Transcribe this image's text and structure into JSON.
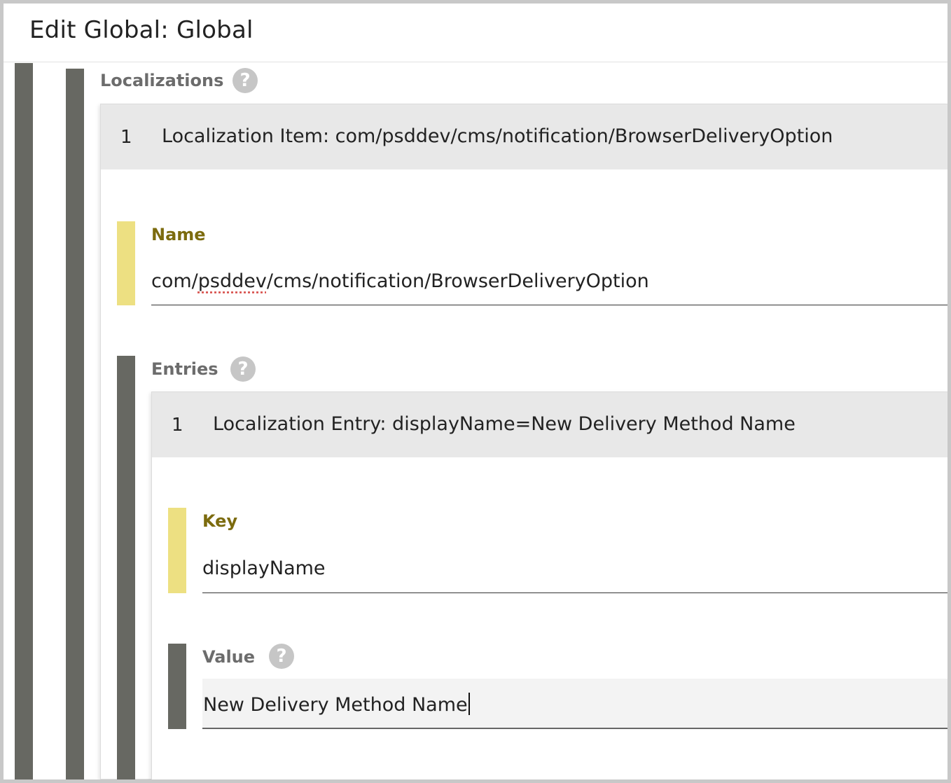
{
  "header": {
    "title": "Edit Global: Global"
  },
  "localizations": {
    "label": "Localizations",
    "help_icon": "question-mark-icon",
    "items": [
      {
        "index": "1",
        "title": "Localization Item: com/psddev/cms/notification/BrowserDeliveryOption",
        "name_field": {
          "label": "Name",
          "value_prefix": "com/",
          "value_flagged": "psddev",
          "value_suffix": "/cms/notification/BrowserDeliveryOption"
        },
        "entries": {
          "label": "Entries",
          "help_icon": "question-mark-icon",
          "items": [
            {
              "index": "1",
              "title": "Localization Entry: displayName=New Delivery Method Name",
              "key_field": {
                "label": "Key",
                "value": "displayName"
              },
              "value_field": {
                "label": "Value",
                "help_icon": "question-mark-icon",
                "value": "New Delivery Method Name"
              }
            }
          ]
        }
      }
    ]
  },
  "colors": {
    "nesting_bar": "#676862",
    "required_bar": "#ede082",
    "field_label": "#7c6b0e",
    "panel_header_bg": "#e8e8e8",
    "help_icon_bg": "#c6c6c6"
  }
}
